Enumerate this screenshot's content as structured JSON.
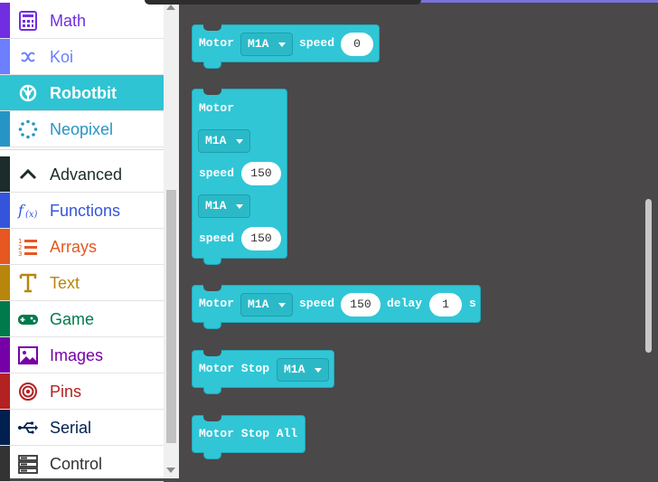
{
  "toolbox": {
    "categories": [
      {
        "label": "Math",
        "color": "#712ee0",
        "icon": "calculator-icon"
      },
      {
        "label": "Koi",
        "color": "#6b7fff",
        "icon": "koi-icon"
      },
      {
        "label": "Robotbit",
        "color": "#2ec4d3",
        "icon": "rebel-icon",
        "selected": true
      },
      {
        "label": "Neopixel",
        "color": "#2695c6",
        "icon": "neopixel-icon"
      },
      {
        "label": "Advanced",
        "color": "#1c2b2b",
        "icon": "chevron-up-icon"
      },
      {
        "label": "Functions",
        "color": "#3455db",
        "icon": "function-icon"
      },
      {
        "label": "Arrays",
        "color": "#e65722",
        "icon": "list-icon"
      },
      {
        "label": "Text",
        "color": "#b8860b",
        "icon": "text-icon"
      },
      {
        "label": "Game",
        "color": "#007a4b",
        "icon": "gamepad-icon"
      },
      {
        "label": "Images",
        "color": "#7600a8",
        "icon": "image-icon"
      },
      {
        "label": "Pins",
        "color": "#b22222",
        "icon": "target-icon"
      },
      {
        "label": "Serial",
        "color": "#002050",
        "icon": "usb-icon"
      },
      {
        "label": "Control",
        "color": "#333333",
        "icon": "server-icon"
      }
    ]
  },
  "blocks": {
    "b1": {
      "motor": "Motor",
      "dd": "M1A",
      "speed": "speed",
      "val": "0"
    },
    "b2": {
      "motor": "Motor",
      "dd1": "M1A",
      "speed1": "speed",
      "val1": "150",
      "dd2": "M1A",
      "speed2": "speed",
      "val2": "150"
    },
    "b3": {
      "motor": "Motor",
      "dd": "M1A",
      "speed": "speed",
      "val": "150",
      "delay": "delay",
      "dval": "1",
      "unit": "s"
    },
    "b4": {
      "label": "Motor Stop",
      "dd": "M1A"
    },
    "b5": {
      "label": "Motor Stop All"
    }
  },
  "colors": {
    "block": "#30c6d6",
    "workspace": "#4a4849"
  }
}
